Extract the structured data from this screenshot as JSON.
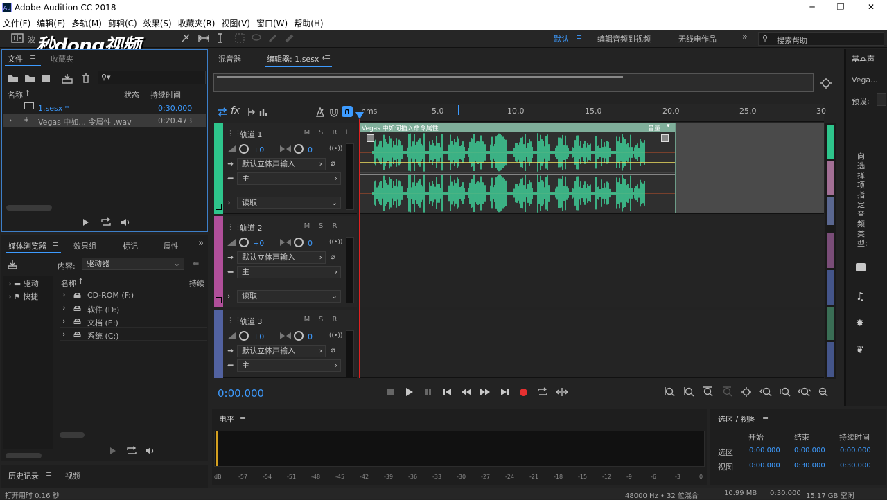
{
  "window": {
    "title": "Adobe Audition CC 2018",
    "app_icon": "Au",
    "min": "─",
    "max": "❐",
    "close": "✕"
  },
  "menu": [
    "文件(F)",
    "编辑(E)",
    "多轨(M)",
    "剪辑(C)",
    "效果(S)",
    "收藏夹(R)",
    "视图(V)",
    "窗口(W)",
    "帮助(H)"
  ],
  "watermark": "秒dong视频",
  "toolbar": {
    "workspace_default": "默认",
    "ws1": "编辑音频到视频",
    "ws2": "无线电作品",
    "search_placeholder": "搜索帮助",
    "waveform_tab_fragment": "波"
  },
  "files_panel": {
    "tab_files": "文件",
    "tab_favorites": "收藏夹",
    "col_name": "名称",
    "col_status": "状态",
    "col_duration": "持续时间",
    "rows": [
      {
        "name": "1.sesx *",
        "duration": "0:30.000"
      },
      {
        "name": "Vegas 中如... 令属性 .wav",
        "duration": "0:20.473"
      }
    ]
  },
  "media_panel": {
    "tabs": [
      "媒体浏览器",
      "效果组",
      "标记",
      "属性"
    ],
    "content_label": "内容:",
    "content_value": "驱动器",
    "left_items": [
      "驱动",
      "快捷"
    ],
    "col_name": "名称",
    "col_duration": "持续",
    "drives": [
      "CD-ROM (F:)",
      "软件 (D:)",
      "文档 (E:)",
      "系统 (C:)"
    ]
  },
  "history_panel": {
    "tab_history": "历史记录",
    "tab_video": "视频"
  },
  "status_left": "打开用时 0.16 秒",
  "editor": {
    "tab_mixer": "混音器",
    "tab_editor": "编辑器: 1.sesx *",
    "ruler": {
      "unit": "hms",
      "labels": [
        "5.0",
        "10.0",
        "15.0",
        "20.0",
        "25.0",
        "30"
      ]
    },
    "clip_name": "Vegas 中如何插入命令属性",
    "clip_label": "音量",
    "tracks": [
      {
        "name": "轨道 1",
        "volume": "+0",
        "pan": "0",
        "input": "默认立体声输入",
        "output": "主",
        "mode": "读取",
        "color": "#2ec58c"
      },
      {
        "name": "轨道 2",
        "volume": "+0",
        "pan": "0",
        "input": "默认立体声输入",
        "output": "主",
        "mode": "读取",
        "color": "#b04f9a"
      },
      {
        "name": "轨道 3",
        "volume": "+0",
        "pan": "0",
        "input": "默认立体声输入",
        "output": "主",
        "mode": "",
        "color": "#5262a0"
      }
    ],
    "msr": [
      "M",
      "S",
      "R"
    ],
    "time": "0:00.000"
  },
  "level_panel": {
    "title": "电平",
    "scale": [
      "dB",
      "-57",
      "-54",
      "-51",
      "-48",
      "-45",
      "-42",
      "-39",
      "-36",
      "-33",
      "-30",
      "-27",
      "-24",
      "-21",
      "-18",
      "-15",
      "-12",
      "-9",
      "-6",
      "-3",
      "0"
    ]
  },
  "selection_panel": {
    "title": "选区 / 视图",
    "cols": [
      "开始",
      "结束",
      "持续时间"
    ],
    "rows": [
      {
        "label": "选区",
        "start": "0:00.000",
        "end": "0:00.000",
        "duration": "0:00.000"
      },
      {
        "label": "视图",
        "start": "0:00.000",
        "end": "0:30.000",
        "duration": "0:30.000"
      }
    ]
  },
  "right_panel": {
    "title": "基本声",
    "field": "Vega...",
    "preset": "预设:",
    "prompt": "向选择项指定音频类型:"
  },
  "statusbar": {
    "rate": "48000 Hz • 32 位混合",
    "size": "10.99 MB",
    "duration": "0:30.000",
    "free": "15.17 GB 空闲"
  }
}
